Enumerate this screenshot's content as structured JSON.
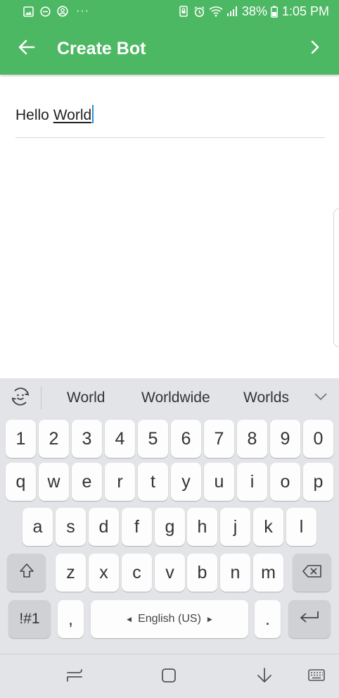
{
  "status_bar": {
    "left_icons": [
      "gallery-icon",
      "do-not-disturb-icon",
      "account-icon"
    ],
    "more": "···",
    "right_icons": [
      "screen-lock-icon",
      "alarm-icon",
      "wifi-icon",
      "signal-icon"
    ],
    "battery": "38%",
    "time": "1:05 PM",
    "color": "#4db863"
  },
  "app_bar": {
    "title": "Create Bot",
    "back_icon": "arrow-left-icon",
    "next_icon": "chevron-right-icon",
    "color": "#4db863"
  },
  "field": {
    "text_before": "Hello ",
    "composing_word": "World",
    "caret_color": "#2a8fd8"
  },
  "keyboard": {
    "sticker_icon": "sticker-icon",
    "suggestions": [
      "World",
      "Worldwide",
      "Worlds"
    ],
    "expand_icon": "chevron-down-icon",
    "row_numbers": [
      "1",
      "2",
      "3",
      "4",
      "5",
      "6",
      "7",
      "8",
      "9",
      "0"
    ],
    "row1": [
      "q",
      "w",
      "e",
      "r",
      "t",
      "y",
      "u",
      "i",
      "o",
      "p"
    ],
    "row2": [
      "a",
      "s",
      "d",
      "f",
      "g",
      "h",
      "j",
      "k",
      "l"
    ],
    "row3": [
      "z",
      "x",
      "c",
      "v",
      "b",
      "n",
      "m"
    ],
    "shift_icon": "shift-icon",
    "backspace_icon": "backspace-icon",
    "symbols": "!#1",
    "comma": ",",
    "space": "English (US)",
    "period": ".",
    "enter_icon": "enter-icon"
  },
  "nav_bar": {
    "icons": [
      "recent-apps-icon",
      "home-icon",
      "hide-keyboard-icon",
      "keyboard-switch-icon"
    ]
  }
}
